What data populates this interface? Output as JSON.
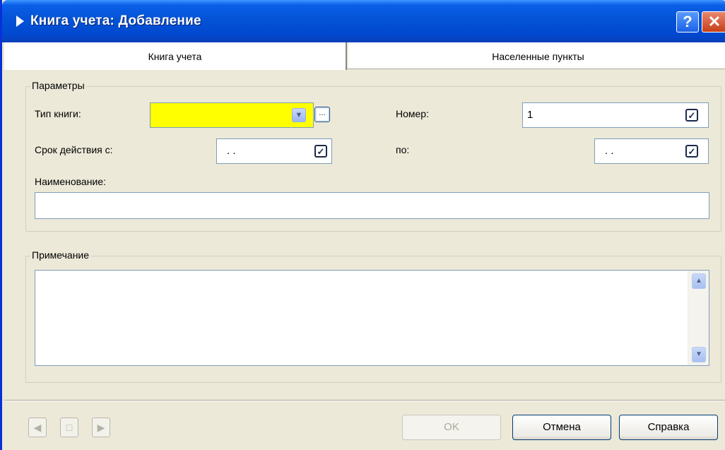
{
  "window": {
    "title": "Книга учета: Добавление",
    "help_label": "?",
    "close_label": "✕"
  },
  "tabs": [
    {
      "label": "Книга учета",
      "active": true
    },
    {
      "label": "Населенные пункты",
      "active": false
    }
  ],
  "parameters": {
    "legend": "Параметры",
    "book_type": {
      "label": "Тип книги:",
      "value": ""
    },
    "number": {
      "label": "Номер:",
      "value": "1",
      "checked": true
    },
    "valid_from": {
      "label": "Срок действия с:",
      "value": ". .",
      "checked": true
    },
    "valid_to": {
      "label": "по:",
      "value": ". .",
      "checked": true
    },
    "name": {
      "label": "Наименование:",
      "value": ""
    }
  },
  "note": {
    "legend": "Примечание",
    "value": ""
  },
  "footer": {
    "ok_label": "OK",
    "cancel_label": "Отмена",
    "help_label": "Справка"
  },
  "colors": {
    "title_bar": "#0453D6",
    "required_field": "#FFFF00",
    "dialog_bg": "#ECE9D8"
  },
  "icons": {
    "title": "triangle-right-icon",
    "prev": "arrow-left-icon",
    "new": "page-icon",
    "next": "arrow-right-icon"
  }
}
